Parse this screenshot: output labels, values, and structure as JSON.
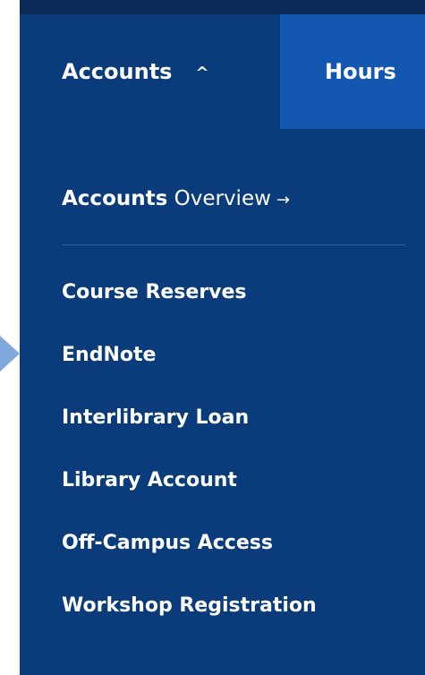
{
  "nav": {
    "accounts_label": "Accounts",
    "hours_label": "Hours",
    "chevron": "^"
  },
  "menu": {
    "overview_bold": "Accounts",
    "overview_rest": " Overview",
    "overview_arrow": "→",
    "items": [
      {
        "label": "Course Reserves"
      },
      {
        "label": "EndNote"
      },
      {
        "label": "Interlibrary Loan"
      },
      {
        "label": "Library Account"
      },
      {
        "label": "Off-Campus Access"
      },
      {
        "label": "Workshop Registration"
      }
    ]
  },
  "colors": {
    "panel": "#0a3b7b",
    "hours_tab": "#1457b0",
    "top_strip": "#0b2a57",
    "text": "#ffffff",
    "pointer": "#7fa8dc"
  }
}
